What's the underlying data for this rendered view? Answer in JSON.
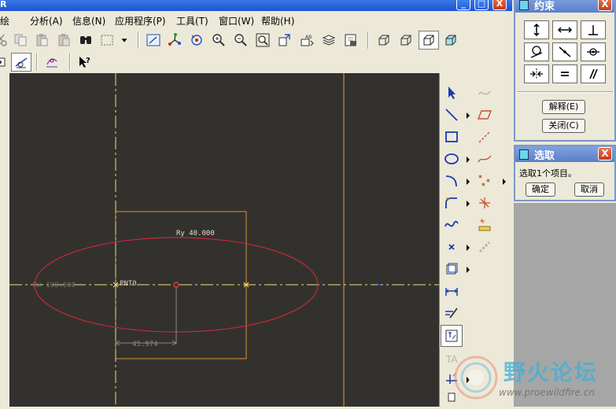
{
  "window": {
    "title": "R",
    "min_label": "_",
    "max_label": "□",
    "close_label": "X"
  },
  "menu": {
    "items": [
      "绘",
      "分析(A)",
      "信息(N)",
      "应用程序(P)",
      "工具(T)",
      "窗口(W)",
      "帮助(H)"
    ]
  },
  "toolbar": {
    "icons": [
      "cut-icon",
      "copy-icon",
      "paste-icon",
      "paste-special-icon",
      "find-icon",
      "select-box-icon",
      "dropdown-icon",
      "repaint-icon",
      "spin-center-icon",
      "orient-icon",
      "zoom-in-icon",
      "zoom-out-icon",
      "refit-icon",
      "reorient-icon",
      "dimension-display-icon",
      "layers-icon",
      "saved-view-icon",
      "wireframe-icon",
      "hidden-line-icon",
      "no-hidden-icon",
      "shading-icon",
      "sketch-orient-icon",
      "datum-display-icon",
      "help-context-icon"
    ]
  },
  "sketch": {
    "ry_label": "Ry 40.000",
    "rx_label": "Rx 100.000",
    "point_label": "PNT0",
    "dim_label": "45.974"
  },
  "colors": {
    "canvas": "#33312e",
    "ellipse": "#c8283c",
    "centerline": "#f2e070",
    "box": "#d89038",
    "dimension": "#8a8a80"
  },
  "constraints_dialog": {
    "title": "约束",
    "buttons": [
      "vertical-icon",
      "horizontal-icon",
      "perpendicular-icon",
      "tangent-icon",
      "midpoint-icon",
      "coincident-icon",
      "symmetric-icon",
      "equal-icon",
      "parallel-icon"
    ],
    "explain_label": "解释(E)",
    "close_label": "关闭(C)",
    "close_x": "X"
  },
  "select_dialog": {
    "title": "选取",
    "message": "选取1个项目。",
    "ok_label": "确定",
    "cancel_label": "取消",
    "close_x": "X"
  },
  "watermark": {
    "text": "野火论坛",
    "url": "www.proewildfire.cn"
  }
}
